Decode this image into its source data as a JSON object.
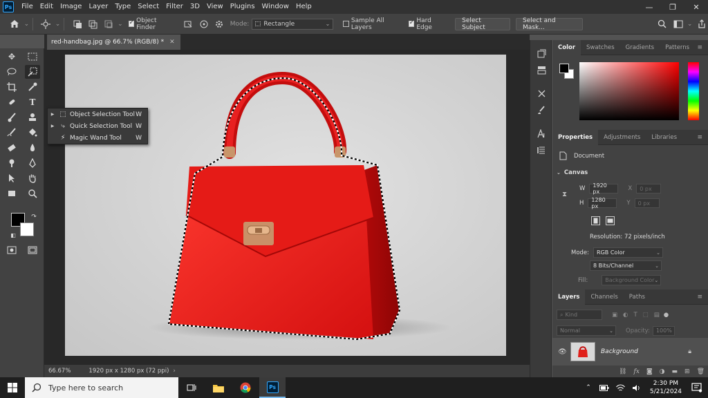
{
  "app": {
    "logo": "Ps"
  },
  "menu": [
    "File",
    "Edit",
    "Image",
    "Layer",
    "Type",
    "Select",
    "Filter",
    "3D",
    "View",
    "Plugins",
    "Window",
    "Help"
  ],
  "window_controls": [
    "—",
    "❐",
    "✕"
  ],
  "options": {
    "object_finder": "Object Finder",
    "mode_label": "Mode:",
    "mode_value": "Rectangle",
    "sample_all_layers": "Sample All Layers",
    "hard_edge": "Hard Edge",
    "select_subject": "Select Subject",
    "select_and_mask": "Select and Mask..."
  },
  "document": {
    "tab_title": "red-handbag.jpg @ 66.7% (RGB/8) *",
    "zoom": "66.67%",
    "size_info": "1920 px x 1280 px (72 ppi)"
  },
  "flyout": {
    "items": [
      {
        "label": "Object Selection Tool",
        "key": "W"
      },
      {
        "label": "Quick Selection Tool",
        "key": "W"
      },
      {
        "label": "Magic Wand Tool",
        "key": "W"
      }
    ]
  },
  "color_panel": {
    "tabs": [
      "Color",
      "Swatches",
      "Gradients",
      "Patterns"
    ]
  },
  "properties": {
    "tabs": [
      "Properties",
      "Adjustments",
      "Libraries"
    ],
    "document_label": "Document",
    "canvas_label": "Canvas",
    "w_label": "W",
    "w_value": "1920 px",
    "h_label": "H",
    "h_value": "1280 px",
    "x_label": "X",
    "x_value": "0 px",
    "y_label": "Y",
    "y_value": "0 px",
    "resolution": "Resolution: 72 pixels/inch",
    "mode_label": "Mode:",
    "mode_value": "RGB Color",
    "bits_value": "8 Bits/Channel",
    "fill_label": "Fill:",
    "fill_value": "Background Color"
  },
  "layers": {
    "tabs": [
      "Layers",
      "Channels",
      "Paths"
    ],
    "kind_placeholder": "Kind",
    "blend_mode": "Normal",
    "opacity_label": "Opacity:",
    "opacity_value": "100%",
    "items": [
      {
        "name": "Background"
      }
    ]
  },
  "taskbar": {
    "search_placeholder": "Type here to search",
    "time": "2:30 PM",
    "date": "5/21/2024"
  }
}
